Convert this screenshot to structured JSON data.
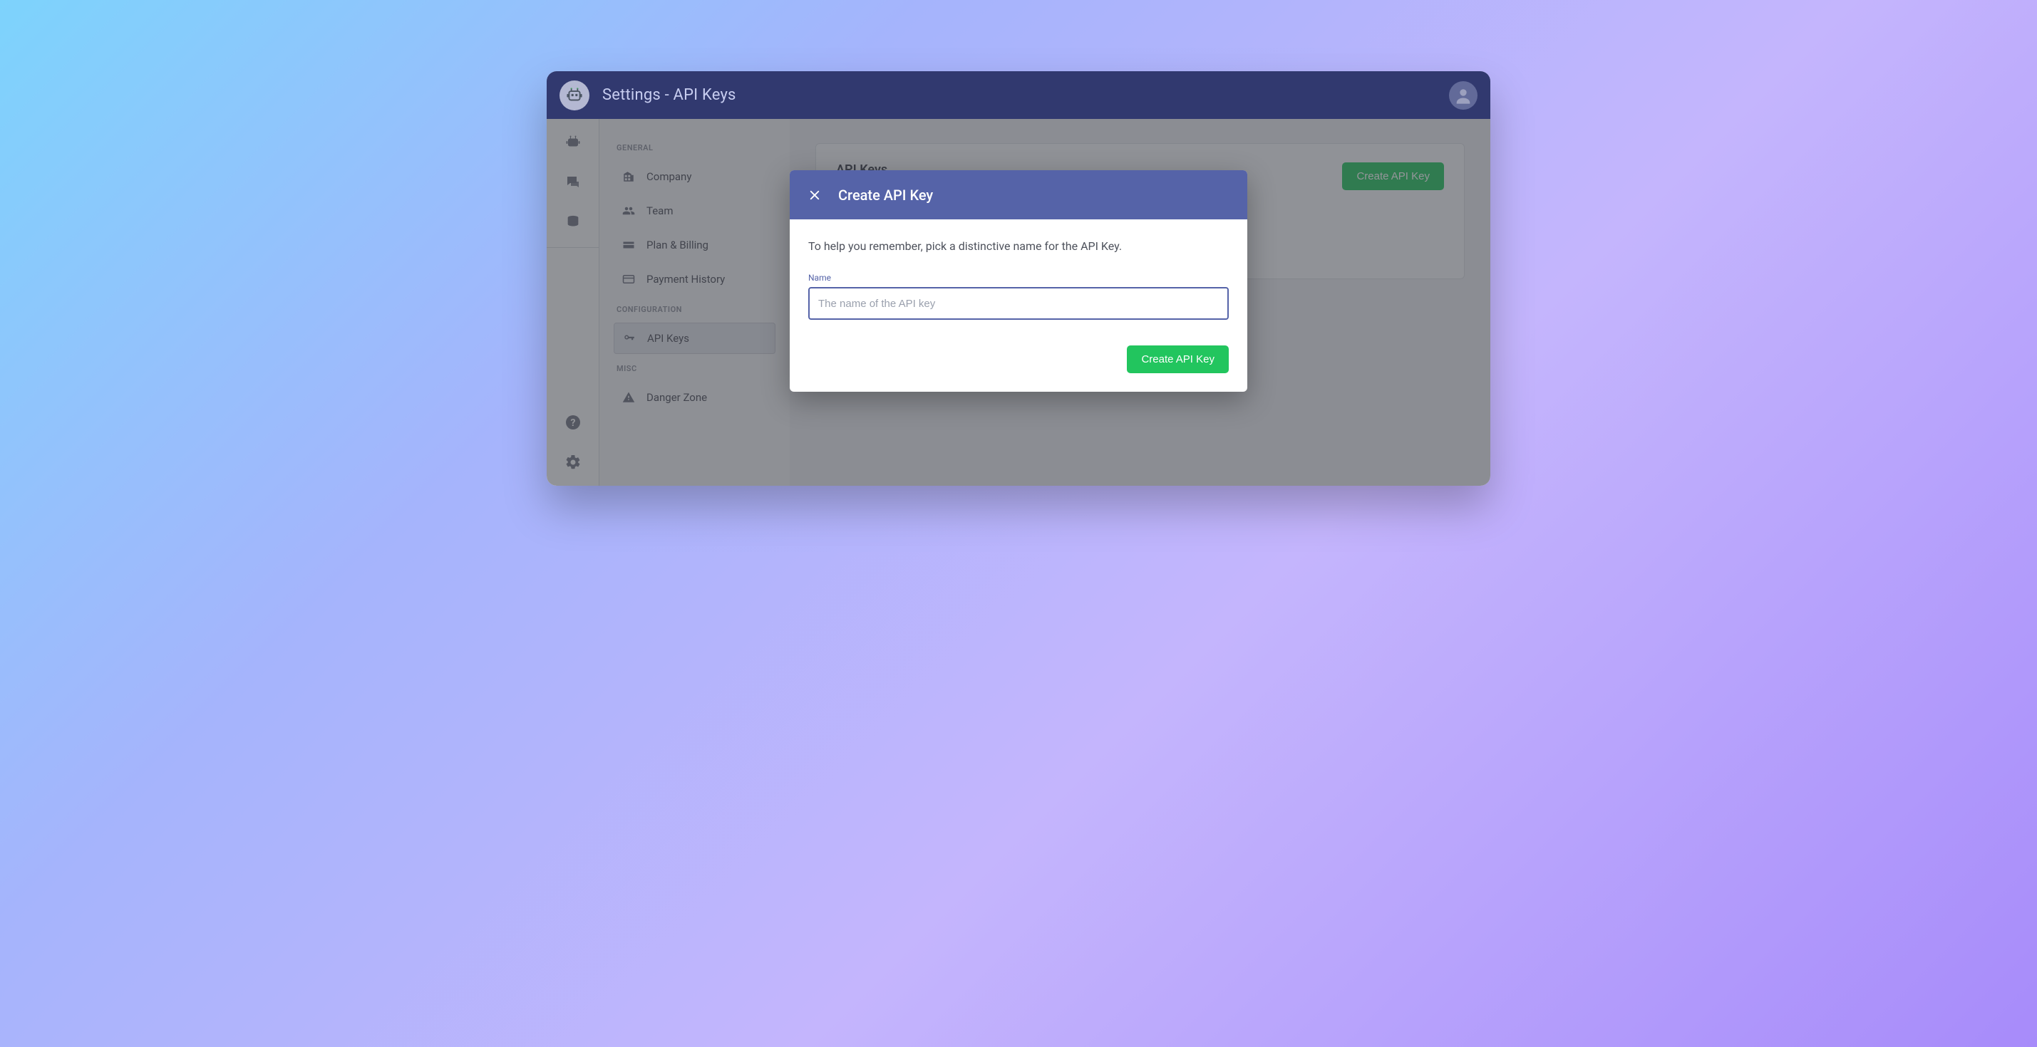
{
  "header": {
    "title": "Settings - API Keys"
  },
  "sidebar": {
    "sections": {
      "general": {
        "label": "GENERAL"
      },
      "configuration": {
        "label": "CONFIGURATION"
      },
      "misc": {
        "label": "MISC"
      }
    },
    "items": {
      "company": {
        "label": "Company"
      },
      "team": {
        "label": "Team"
      },
      "plan_billing": {
        "label": "Plan & Billing"
      },
      "payment_history": {
        "label": "Payment History"
      },
      "api_keys": {
        "label": "API Keys"
      },
      "danger_zone": {
        "label": "Danger Zone"
      }
    }
  },
  "main": {
    "card_title": "API Keys",
    "create_button": "Create API Key"
  },
  "modal": {
    "title": "Create API Key",
    "helper": "To help you remember, pick a distinctive name for the API Key.",
    "name_label": "Name",
    "name_placeholder": "The name of the API key",
    "name_value": "",
    "submit_button": "Create API Key"
  },
  "colors": {
    "header_bg": "#31396f",
    "modal_header_bg": "#5563a8",
    "primary_green": "#22c55e"
  }
}
